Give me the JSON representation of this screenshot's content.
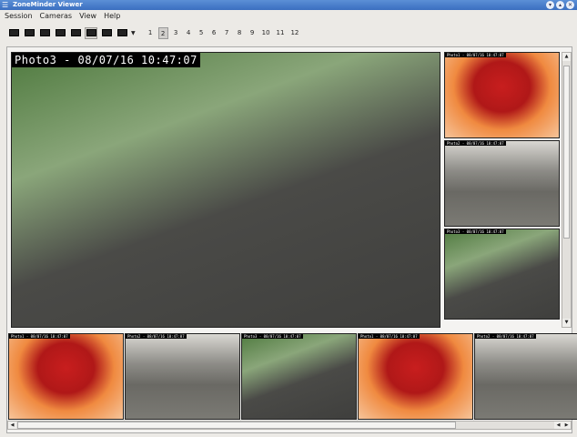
{
  "window": {
    "title": "ZoneMinder Viewer",
    "app_icon": "zoneminder-icon",
    "controls": [
      "minimize-icon",
      "maximize-icon",
      "close-icon"
    ]
  },
  "menu": [
    "Session",
    "Cameras",
    "View",
    "Help"
  ],
  "toolbar": {
    "layouts": [
      "layout-1x1",
      "layout-2x2",
      "layout-3x3",
      "layout-4x4",
      "layout-5x5",
      "layout-1-plus-5",
      "layout-1-plus-7",
      "layout-custom"
    ],
    "active_layout": "layout-1-plus-5",
    "pages": [
      "1",
      "2",
      "3",
      "4",
      "5",
      "6",
      "7",
      "8",
      "9",
      "10",
      "11",
      "12"
    ],
    "active_page": "2"
  },
  "main_camera": {
    "label": "Photo3 - 08/07/16 10:47:07",
    "scene": "outdoor"
  },
  "side_cameras": [
    {
      "label": "Photo1 - 08/07/16 10:47:07",
      "scene": "stage"
    },
    {
      "label": "Photo2 - 08/07/16 10:47:07",
      "scene": "parking"
    },
    {
      "label": "Photo3 - 08/07/16 10:47:07",
      "scene": "outdoor"
    }
  ],
  "strip_cameras": [
    {
      "label": "Photo1 - 08/07/16 10:47:07",
      "scene": "stage"
    },
    {
      "label": "Photo2 - 08/07/16 10:47:07",
      "scene": "parking"
    },
    {
      "label": "Photo3 - 08/07/16 10:47:07",
      "scene": "outdoor"
    },
    {
      "label": "Photo1 - 08/07/16 10:47:07",
      "scene": "stage"
    },
    {
      "label": "Photo2 - 08/07/16 10:47:07",
      "scene": "parking"
    }
  ]
}
